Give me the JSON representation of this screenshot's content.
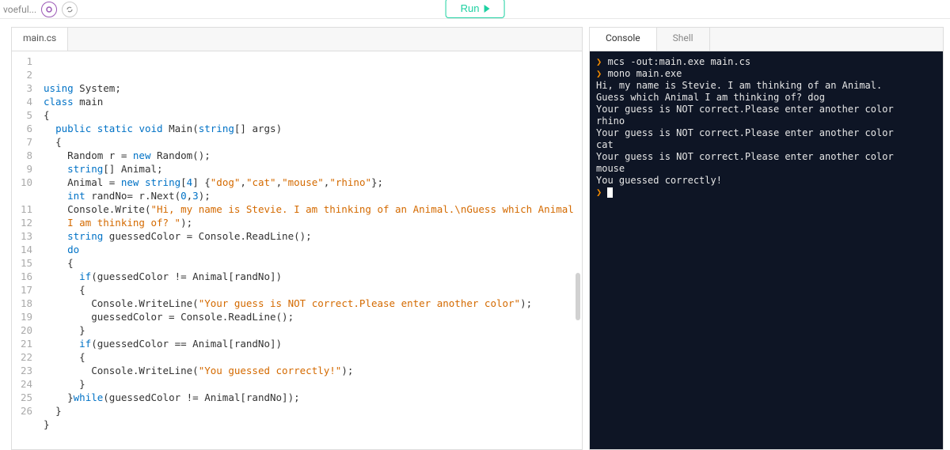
{
  "topbar": {
    "project_name_fragment": "voeful...",
    "run_label": "Run"
  },
  "editor": {
    "filename": "main.cs",
    "line_count": 26,
    "code_lines": [
      [
        [
          "kw",
          "using"
        ],
        [
          "pun",
          " "
        ],
        [
          "id",
          "System"
        ],
        [
          "pun",
          ";"
        ]
      ],
      [
        [
          "kw",
          "class"
        ],
        [
          "pun",
          " "
        ],
        [
          "id",
          "main"
        ]
      ],
      [
        [
          "pun",
          "{"
        ]
      ],
      [
        [
          "pun",
          "  "
        ],
        [
          "kw",
          "public"
        ],
        [
          "pun",
          " "
        ],
        [
          "kw",
          "static"
        ],
        [
          "pun",
          " "
        ],
        [
          "kw",
          "void"
        ],
        [
          "pun",
          " "
        ],
        [
          "id",
          "Main"
        ],
        [
          "pun",
          "("
        ],
        [
          "type",
          "string"
        ],
        [
          "pun",
          "[] "
        ],
        [
          "id",
          "args"
        ],
        [
          "pun",
          ")"
        ]
      ],
      [
        [
          "pun",
          "  {"
        ]
      ],
      [
        [
          "pun",
          "    "
        ],
        [
          "id",
          "Random r "
        ],
        [
          "pun",
          "= "
        ],
        [
          "new",
          "new"
        ],
        [
          "pun",
          " "
        ],
        [
          "id",
          "Random"
        ],
        [
          "pun",
          "();"
        ]
      ],
      [
        [
          "pun",
          "    "
        ],
        [
          "type",
          "string"
        ],
        [
          "pun",
          "[] "
        ],
        [
          "id",
          "Animal"
        ],
        [
          "pun",
          ";"
        ]
      ],
      [
        [
          "pun",
          "    "
        ],
        [
          "id",
          "Animal "
        ],
        [
          "pun",
          "= "
        ],
        [
          "new",
          "new"
        ],
        [
          "pun",
          " "
        ],
        [
          "type",
          "string"
        ],
        [
          "pun",
          "["
        ],
        [
          "num",
          "4"
        ],
        [
          "pun",
          "] {"
        ],
        [
          "str",
          "\"dog\""
        ],
        [
          "pun",
          ","
        ],
        [
          "str",
          "\"cat\""
        ],
        [
          "pun",
          ","
        ],
        [
          "str",
          "\"mouse\""
        ],
        [
          "pun",
          ","
        ],
        [
          "str",
          "\"rhino\""
        ],
        [
          "pun",
          "};"
        ]
      ],
      [
        [
          "pun",
          "    "
        ],
        [
          "kw",
          "int"
        ],
        [
          "pun",
          " "
        ],
        [
          "id",
          "randNo"
        ],
        [
          "pun",
          "= r.Next("
        ],
        [
          "num",
          "0"
        ],
        [
          "pun",
          ","
        ],
        [
          "num",
          "3"
        ],
        [
          "pun",
          ");"
        ]
      ],
      [
        [
          "pun",
          "    "
        ],
        [
          "id",
          "Console"
        ],
        [
          "pun",
          ".Write("
        ],
        [
          "str",
          "\"Hi, my name is Stevie. I am thinking of an Animal.\\nGuess which Animal I am thinking of? \""
        ],
        [
          "pun",
          ");"
        ]
      ],
      [
        [
          "pun",
          "    "
        ],
        [
          "type",
          "string"
        ],
        [
          "pun",
          " "
        ],
        [
          "id",
          "guessedColor"
        ],
        [
          "pun",
          " = Console.ReadLine();"
        ]
      ],
      [
        [
          "pun",
          "    "
        ],
        [
          "kw",
          "do"
        ]
      ],
      [
        [
          "pun",
          "    {"
        ]
      ],
      [
        [
          "pun",
          "      "
        ],
        [
          "kw",
          "if"
        ],
        [
          "pun",
          "(guessedColor != Animal[randNo])"
        ]
      ],
      [
        [
          "pun",
          "      {"
        ]
      ],
      [
        [
          "pun",
          "        "
        ],
        [
          "id",
          "Console"
        ],
        [
          "pun",
          ".WriteLine("
        ],
        [
          "str",
          "\"Your guess is NOT correct.Please enter another color\""
        ],
        [
          "pun",
          ");"
        ]
      ],
      [
        [
          "pun",
          "        "
        ],
        [
          "id",
          "guessedColor"
        ],
        [
          "pun",
          " = Console.ReadLine();"
        ]
      ],
      [
        [
          "pun",
          "      }"
        ]
      ],
      [
        [
          "pun",
          "      "
        ],
        [
          "kw",
          "if"
        ],
        [
          "pun",
          "(guessedColor == Animal[randNo])"
        ]
      ],
      [
        [
          "pun",
          "      {"
        ]
      ],
      [
        [
          "pun",
          "        "
        ],
        [
          "id",
          "Console"
        ],
        [
          "pun",
          ".WriteLine("
        ],
        [
          "str",
          "\"You guessed correctly!\""
        ],
        [
          "pun",
          ");"
        ]
      ],
      [
        [
          "pun",
          "      }"
        ]
      ],
      [
        [
          "pun",
          "    }"
        ],
        [
          "kw",
          "while"
        ],
        [
          "pun",
          "(guessedColor != Animal[randNo]);"
        ]
      ],
      [
        [
          "pun",
          "  }"
        ]
      ],
      [
        [
          "pun",
          "}"
        ]
      ],
      [
        [
          "pun",
          ""
        ]
      ]
    ],
    "wrap_for_line_10_at": 88
  },
  "output_tabs": {
    "console": "Console",
    "shell": "Shell"
  },
  "console": {
    "prompt": "❯",
    "lines": [
      {
        "prompt": true,
        "text": "mcs -out:main.exe main.cs"
      },
      {
        "prompt": true,
        "text": "mono main.exe"
      },
      {
        "prompt": false,
        "text": "Hi, my name is Stevie. I am thinking of an Animal."
      },
      {
        "prompt": false,
        "text": "Guess which Animal I am thinking of? dog"
      },
      {
        "prompt": false,
        "text": "Your guess is NOT correct.Please enter another color"
      },
      {
        "prompt": false,
        "text": "rhino"
      },
      {
        "prompt": false,
        "text": "Your guess is NOT correct.Please enter another color"
      },
      {
        "prompt": false,
        "text": "cat"
      },
      {
        "prompt": false,
        "text": "Your guess is NOT correct.Please enter another color"
      },
      {
        "prompt": false,
        "text": "mouse"
      },
      {
        "prompt": false,
        "text": "You guessed correctly!"
      }
    ]
  },
  "colors": {
    "run_green": "#1dd1a1",
    "console_bg": "#0e1525",
    "keyword": "#0072c6",
    "string": "#d46a00",
    "prompt": "#f38b00"
  }
}
